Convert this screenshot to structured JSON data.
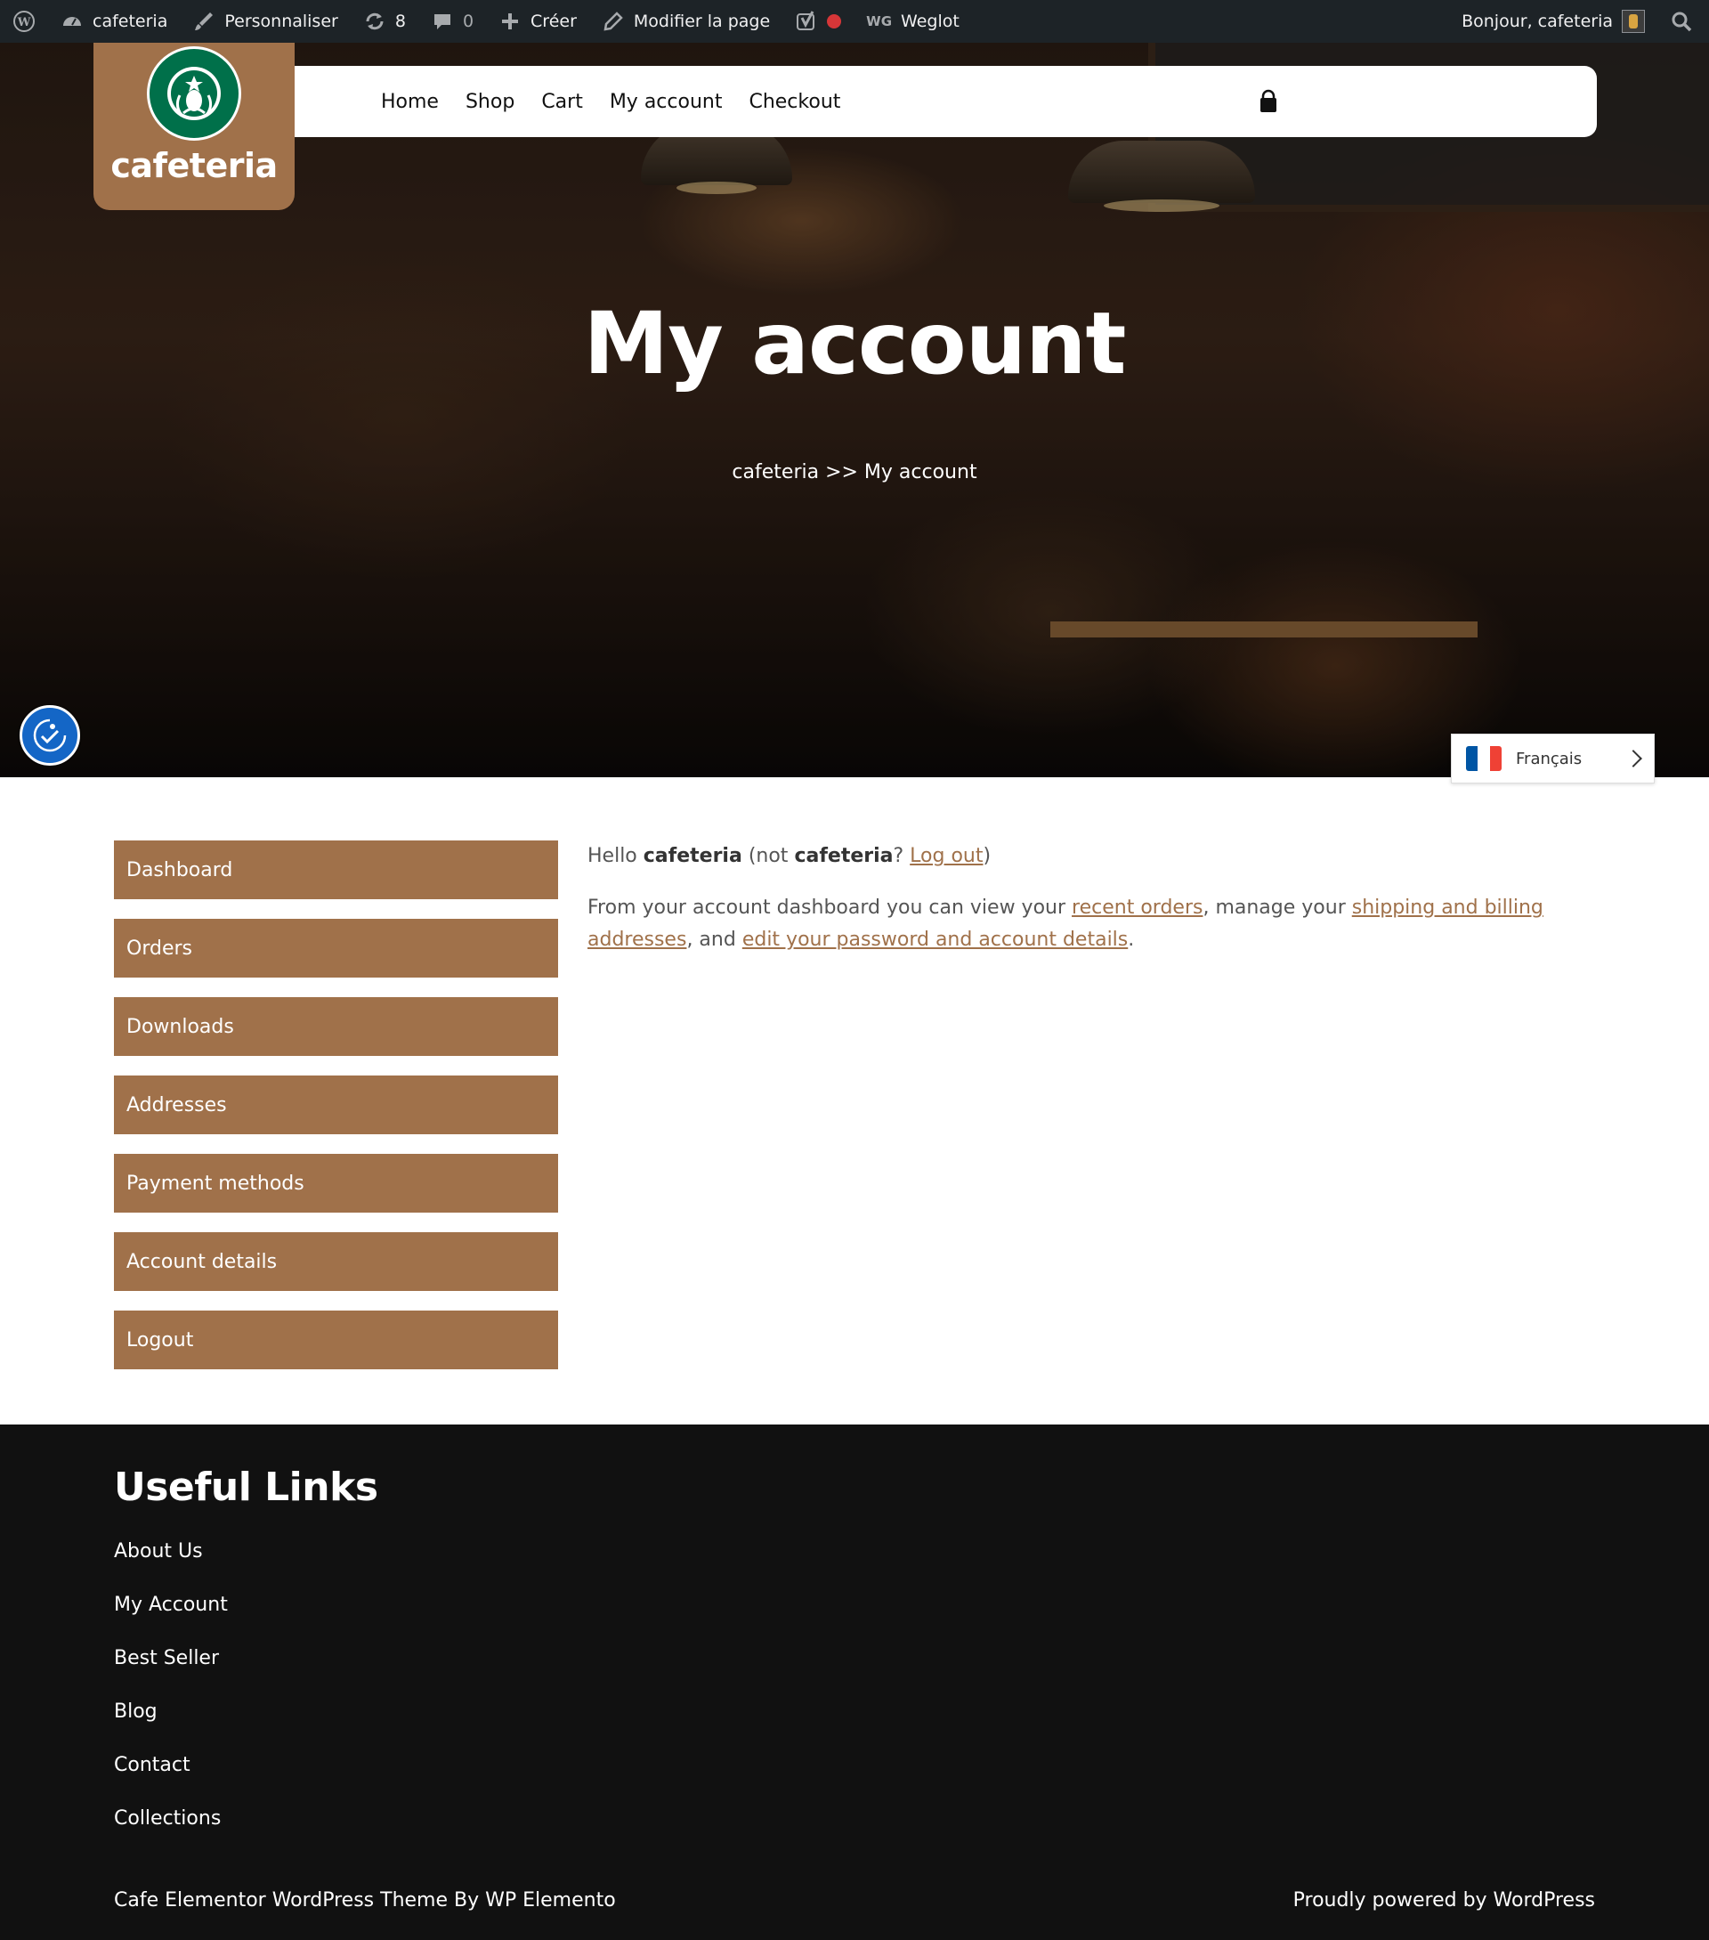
{
  "adminbar": {
    "site_name": "cafeteria",
    "customize": "Personnaliser",
    "updates_count": "8",
    "comments_count": "0",
    "new": "Créer",
    "edit_page": "Modifier la page",
    "weglot_badge": "WG",
    "weglot": "Weglot",
    "greeting": "Bonjour, cafeteria"
  },
  "header": {
    "logo_text": "cafeteria",
    "nav": [
      "Home",
      "Shop",
      "Cart",
      "My account",
      "Checkout"
    ]
  },
  "hero": {
    "title": "My account",
    "breadcrumb": "cafeteria >> My account"
  },
  "language": {
    "current": "Français",
    "flag_colors": [
      "#0055a4",
      "#ffffff",
      "#ef4135"
    ]
  },
  "account": {
    "nav": [
      "Dashboard",
      "Orders",
      "Downloads",
      "Addresses",
      "Payment methods",
      "Account details",
      "Logout"
    ],
    "hello_prefix": "Hello ",
    "user": "cafeteria",
    "not_prefix": " (not ",
    "not_user": "cafeteria",
    "question": "? ",
    "logout_link": "Log out",
    "close_paren": ")",
    "intro_text": "From your account dashboard you can view your ",
    "recent_orders_link": "recent orders",
    "manage_text": ", manage your ",
    "addresses_link": "shipping and billing addresses",
    "and_text": ", and ",
    "password_link": "edit your password and account details",
    "period": "."
  },
  "footer": {
    "title": "Useful Links",
    "links": [
      "About Us",
      "My Account",
      "Best Seller",
      "Blog",
      "Contact",
      "Collections"
    ],
    "credit_left": "Cafe Elementor WordPress Theme By WP Elemento",
    "credit_right": "Proudly powered by WordPress"
  },
  "colors": {
    "accent": "#a0714a",
    "adminbar": "#1d2327",
    "footer": "#111111",
    "starbucks_green": "#00704a",
    "accessibility_blue": "#1466c6"
  },
  "icons": [
    "wordpress-icon",
    "dashboard-icon",
    "brush-icon",
    "updates-icon",
    "comment-icon",
    "plus-icon",
    "pencil-icon",
    "yoast-icon",
    "search-icon",
    "shopping-bag-icon",
    "accessibility-icon",
    "chevron-right-icon"
  ]
}
